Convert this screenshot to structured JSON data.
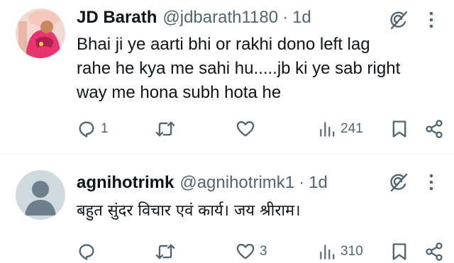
{
  "tweets": [
    {
      "author_name": "JD Barath",
      "handle": "@jdbarath1180",
      "separator": "·",
      "time": "1d",
      "text_lines": [
        "Bhai ji ye aarti bhi or rakhi dono left lag",
        "rahe he kya me sahi hu.....jb ki ye sab right",
        "way me hona subh hota he"
      ],
      "reply_count": "1",
      "retweet_count": "",
      "like_count": "",
      "view_count": "241"
    },
    {
      "author_name": "agnihotrimk",
      "handle": "@agnihotrimk1",
      "separator": "·",
      "time": "1d",
      "text_lines": [
        "बहुत सुंदर विचार एवं कार्य। जय श्रीराम।"
      ],
      "reply_count": "",
      "retweet_count": "",
      "like_count": "3",
      "view_count": "310"
    }
  ],
  "icons": {
    "reply": "reply-icon",
    "retweet": "retweet-icon",
    "like": "heart-icon",
    "views": "views-icon",
    "bookmark": "bookmark-icon",
    "share": "share-icon",
    "grok": "grok-icon",
    "more": "more-icon"
  },
  "colors": {
    "text": "#0f1419",
    "secondary": "#536471",
    "divider": "#eff3f4",
    "avatar_pink": "#e8346f",
    "avatar_default": "#cfd9de"
  }
}
